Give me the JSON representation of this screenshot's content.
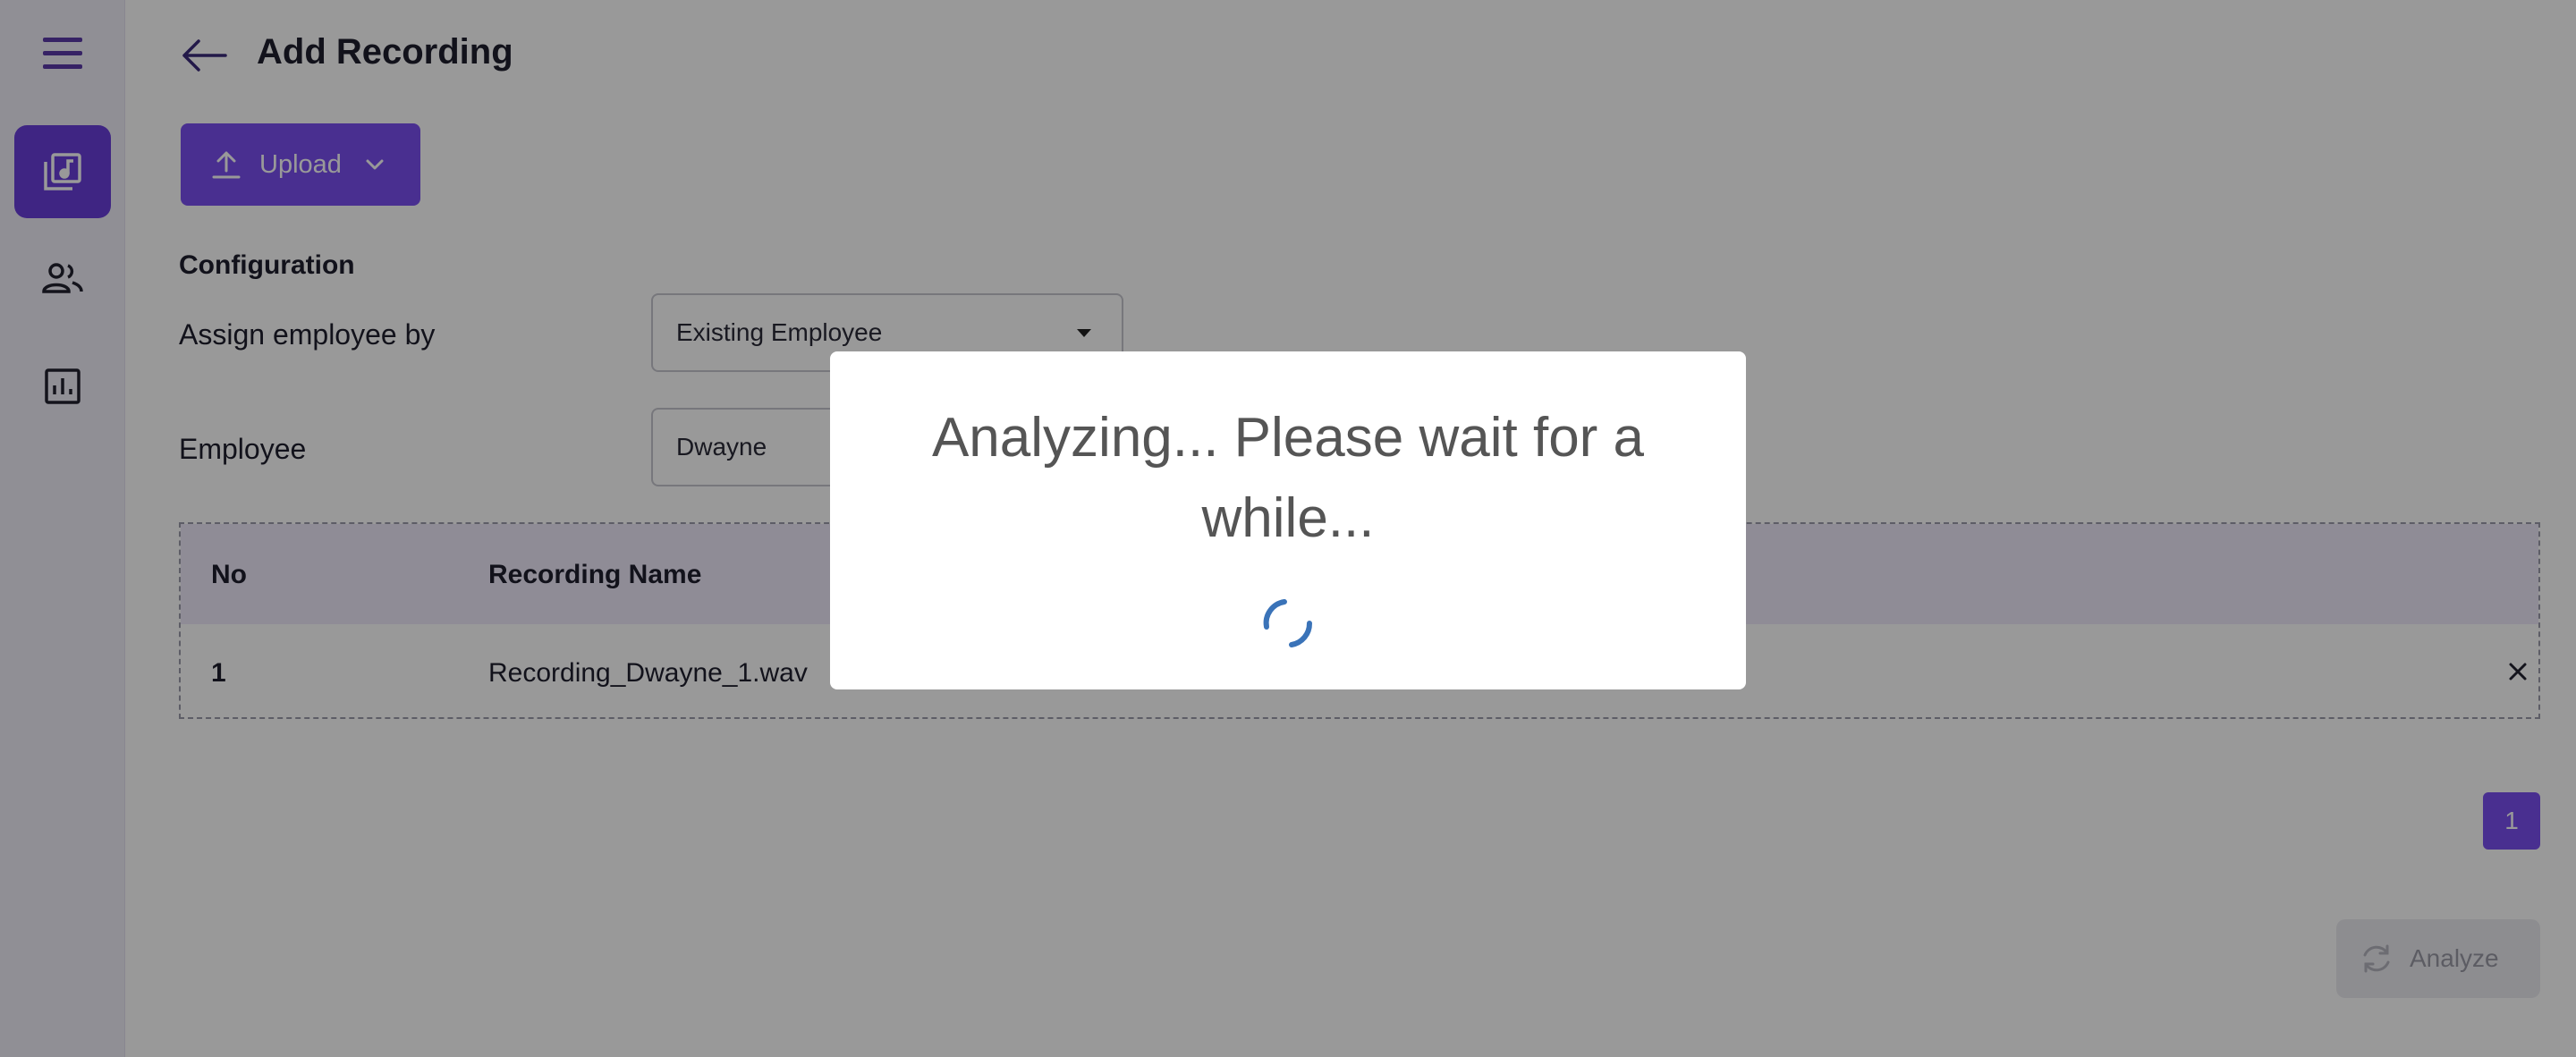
{
  "header": {
    "title": "Add Recording"
  },
  "toolbar": {
    "upload_label": "Upload"
  },
  "configuration": {
    "title": "Configuration",
    "assign_label": "Assign employee by",
    "assign_value": "Existing Employee",
    "employee_label": "Employee",
    "employee_value": "Dwayne"
  },
  "table": {
    "headers": [
      "No",
      "Recording Name"
    ],
    "rows": [
      {
        "no": "1",
        "name": "Recording_Dwayne_1.wav"
      }
    ]
  },
  "pagination": {
    "current": "1"
  },
  "actions": {
    "analyze_label": "Analyze"
  },
  "modal": {
    "message": "Analyzing... Please wait for a while..."
  },
  "colors": {
    "accent": "#7a4ff0",
    "sidebar_bg": "#f1eef9",
    "spinner": "#3a73b8"
  },
  "icons": {
    "menu": "hamburger-icon",
    "recordings": "music-library-icon",
    "employees": "people-icon",
    "reports": "bar-chart-icon",
    "back": "arrow-left-icon",
    "upload": "upload-icon",
    "remove": "close-icon"
  }
}
